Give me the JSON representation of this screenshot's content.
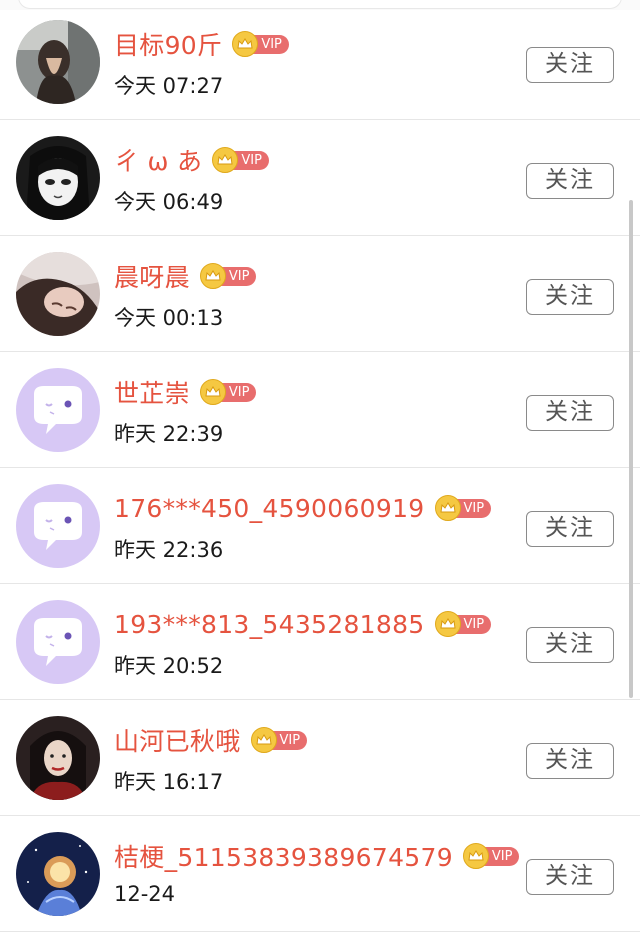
{
  "follow_label": "关注",
  "vip_text": "VIP",
  "users": [
    {
      "name": "目标90斤",
      "time": "今天 07:27",
      "avatar": "photo-hair"
    },
    {
      "name": "ㄔ ω あ",
      "time": "今天 06:49",
      "avatar": "anime-girl"
    },
    {
      "name": "晨呀晨",
      "time": "今天 00:13",
      "avatar": "photo-face"
    },
    {
      "name": "世芷崇",
      "time": "昨天 22:39",
      "avatar": "default-chat"
    },
    {
      "name": "176***450_4590060919",
      "time": "昨天 22:36",
      "avatar": "default-chat"
    },
    {
      "name": "193***813_5435281885",
      "time": "昨天 20:52",
      "avatar": "default-chat"
    },
    {
      "name": "山河已秋哦",
      "time": "昨天 16:17",
      "avatar": "photo-portrait"
    },
    {
      "name": "桔梗_51153839389674579",
      "time": "12-24",
      "avatar": "illustration-night"
    }
  ]
}
